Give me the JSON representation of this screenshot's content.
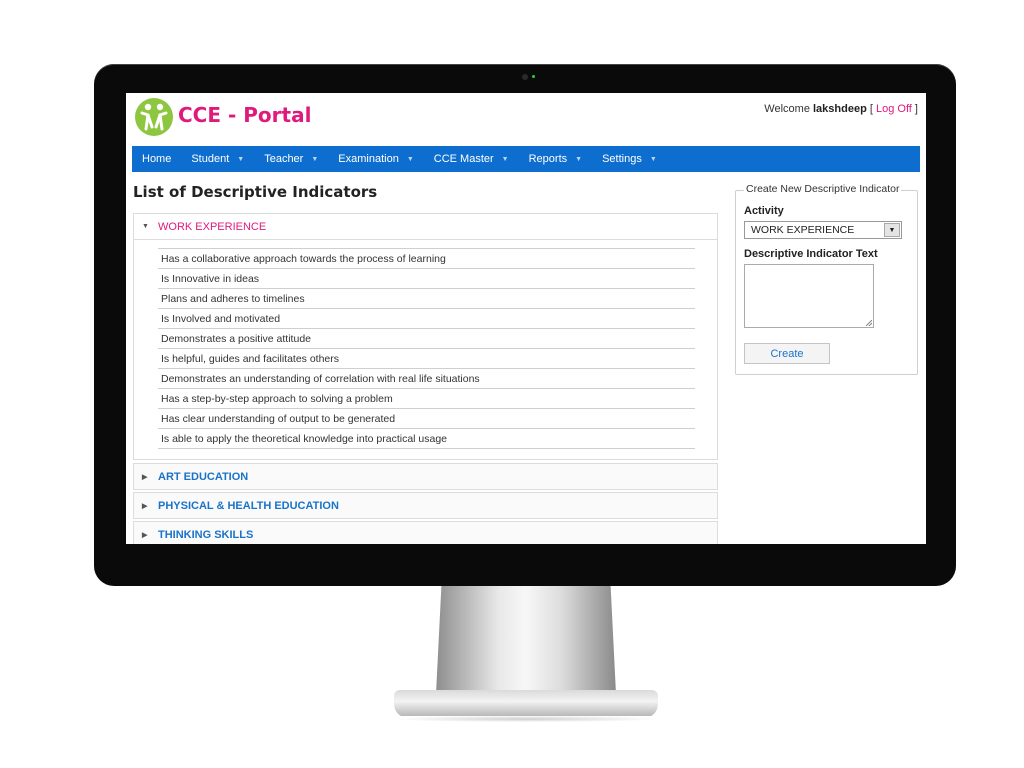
{
  "app": {
    "logo_prefix": "CCE",
    "logo_separator": " - ",
    "logo_suffix": "Portal",
    "brand_colors": {
      "pink": "#e0197d",
      "green": "#8dc63f",
      "nav_blue": "#0e6ecf"
    }
  },
  "header": {
    "welcome_prefix": "Welcome ",
    "username": "lakshdeep",
    "bracket_open": " [ ",
    "logoff_label": "Log Off",
    "bracket_close": " ]"
  },
  "nav": {
    "items": [
      {
        "label": "Home",
        "has_dropdown": false
      },
      {
        "label": "Student",
        "has_dropdown": true
      },
      {
        "label": "Teacher",
        "has_dropdown": true
      },
      {
        "label": "Examination",
        "has_dropdown": true
      },
      {
        "label": "CCE Master",
        "has_dropdown": true
      },
      {
        "label": "Reports",
        "has_dropdown": true
      },
      {
        "label": "Settings",
        "has_dropdown": true
      }
    ]
  },
  "main": {
    "title": "List of Descriptive Indicators",
    "sections": [
      {
        "label": "WORK EXPERIENCE",
        "expanded": true,
        "indicators": [
          "Has a collaborative approach towards the process of learning",
          "Is Innovative in ideas",
          "Plans and adheres to timelines",
          "Is Involved and motivated",
          "Demonstrates a positive attitude",
          "Is helpful, guides and facilitates others",
          "Demonstrates an understanding of correlation with real life situations",
          "Has a step-by-step approach to solving a problem",
          "Has clear understanding of output to be generated",
          "Is able to apply the theoretical knowledge into practical usage"
        ]
      },
      {
        "label": "ART EDUCATION",
        "expanded": false
      },
      {
        "label": "PHYSICAL & HEALTH EDUCATION",
        "expanded": false
      },
      {
        "label": "THINKING SKILLS",
        "expanded": false
      }
    ]
  },
  "create_panel": {
    "legend": "Create New Descriptive Indicator",
    "activity_label": "Activity",
    "activity_value": "WORK EXPERIENCE",
    "text_label": "Descriptive Indicator Text",
    "text_value": "",
    "create_label": "Create"
  }
}
